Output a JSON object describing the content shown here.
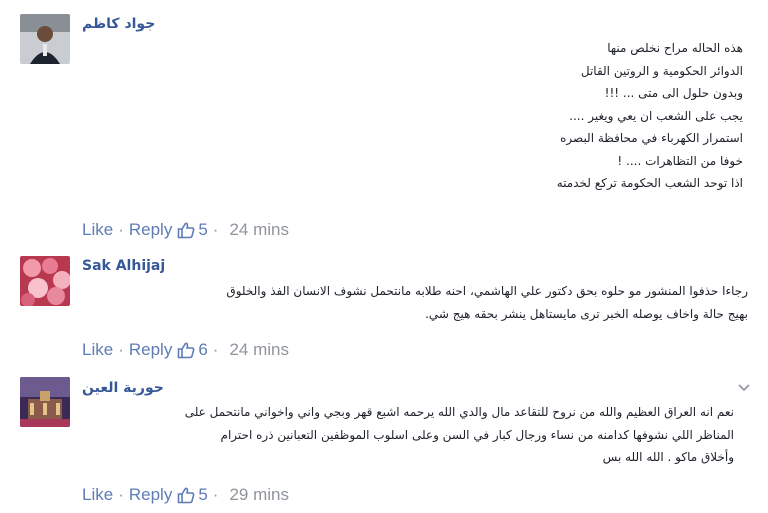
{
  "comments": [
    {
      "author": "جواد كاظم",
      "lines": [
        "هذه الحاله مراح نخلص منها",
        "الدوائر الحكومية و الروتين القاتل",
        "وبدون حلول الى متى ... !!!",
        "يجب على الشعب ان يعي ويغير ....",
        "استمرار الكهرباء في محافظة البصره",
        "خوفا من التظاهرات .... !",
        "اذا توحد الشعب الحكومة تركع لخدمته"
      ],
      "like_label": "Like",
      "reply_label": "Reply",
      "like_count": "5",
      "time": "24 mins",
      "avatar_icon": "person-photo-icon"
    },
    {
      "author": "Sak Alhijaj",
      "lines": [
        "رجاءا حذفوا المنشور مو حلوه بحق دكتور علي الهاشمي، احنه طلابه مانتحمل نشوف الانسان الفذ والخلوق",
        "بهيج حالة واخاف يوصله الخبر ترى مايستاهل ينشر بحقه هيج شي."
      ],
      "like_label": "Like",
      "reply_label": "Reply",
      "like_count": "6",
      "time": "24 mins",
      "avatar_icon": "flowers-photo-icon"
    },
    {
      "author": "حورية العين",
      "lines": [
        "نعم انه العراق العظيم والله من نروح للتقاعد مال والدي الله يرحمه اشبع قهر وبجي واني واخواني مانتحمل على",
        "المناظر اللي نشوفها كدامنه من نساء ورجال كبار في السن وعلى اسلوب الموظفين التعبانين ذره احترام",
        "وأخلاق ماكو . الله الله بس"
      ],
      "like_label": "Like",
      "reply_label": "Reply",
      "like_count": "5",
      "time": "29 mins",
      "avatar_icon": "palace-photo-icon"
    }
  ],
  "separator": "·",
  "colors": {
    "link": "#5e7cb6",
    "name": "#365899",
    "meta": "#90949c",
    "text": "#1d2129"
  }
}
